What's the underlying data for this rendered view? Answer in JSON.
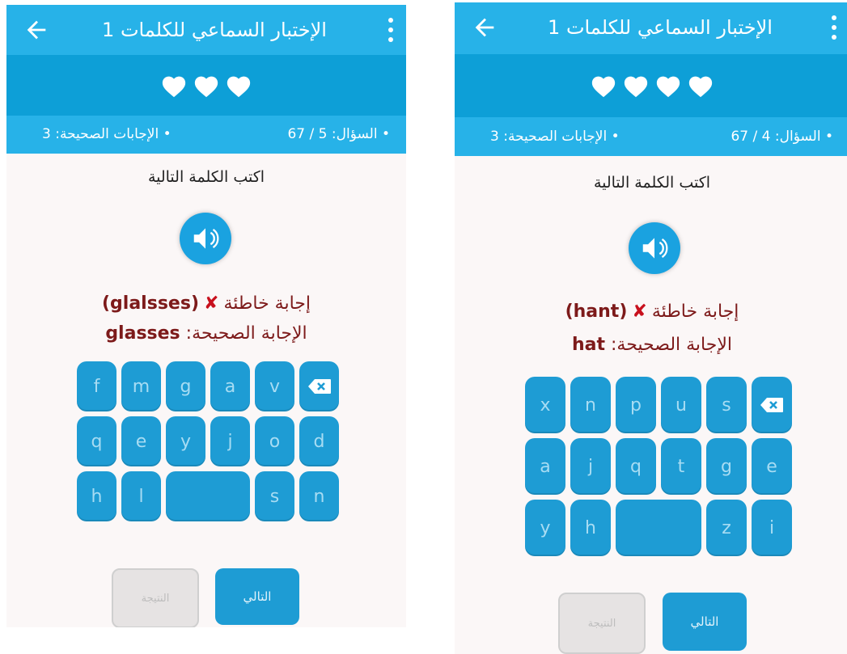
{
  "screens": [
    {
      "title": "الإختبار السماعي للكلمات 1",
      "hearts": 3,
      "question_label": "• السؤال:",
      "question_value": "5 / 67",
      "correct_label": "• الإجابات الصحيحة:",
      "correct_value": "3",
      "instruction": "اكتب الكلمة التالية",
      "wrong_label": "إجابة خاطئة",
      "wrong_answer": "(glalsses)",
      "correct_answer_label": "الإجابة الصحيحة:",
      "correct_answer": "glasses",
      "keys": [
        "f",
        "m",
        "g",
        "a",
        "v",
        "⌫",
        "q",
        "e",
        "y",
        "j",
        "o",
        "d",
        "h",
        "l",
        "",
        "s",
        "n"
      ],
      "result_button": "النتيجة",
      "next_button": "التالي"
    },
    {
      "title": "الإختبار السماعي للكلمات 1",
      "hearts": 4,
      "question_label": "• السؤال:",
      "question_value": "4 / 67",
      "correct_label": "• الإجابات الصحيحة:",
      "correct_value": "3",
      "instruction": "اكتب الكلمة التالية",
      "wrong_label": "إجابة خاطئة",
      "wrong_answer": "(hant)",
      "correct_answer_label": "الإجابة الصحيحة:",
      "correct_answer": "hat",
      "keys": [
        "x",
        "n",
        "p",
        "u",
        "s",
        "⌫",
        "a",
        "j",
        "q",
        "t",
        "g",
        "e",
        "y",
        "h",
        "",
        "z",
        "i"
      ],
      "result_button": "النتيجة",
      "next_button": "التالي"
    }
  ],
  "colors": {
    "toolbar": "#27b2e8",
    "hearts_bar": "#0d9fd7",
    "key": "#1e9cd4",
    "wrong_text": "#7d1a1a",
    "x_mark": "#c8101d"
  },
  "icons": {
    "back": "arrow-left-icon",
    "menu": "more-vert-icon",
    "heart": "heart-icon",
    "speaker": "speaker-icon",
    "backspace": "backspace-icon",
    "wrong": "x-mark-icon"
  }
}
